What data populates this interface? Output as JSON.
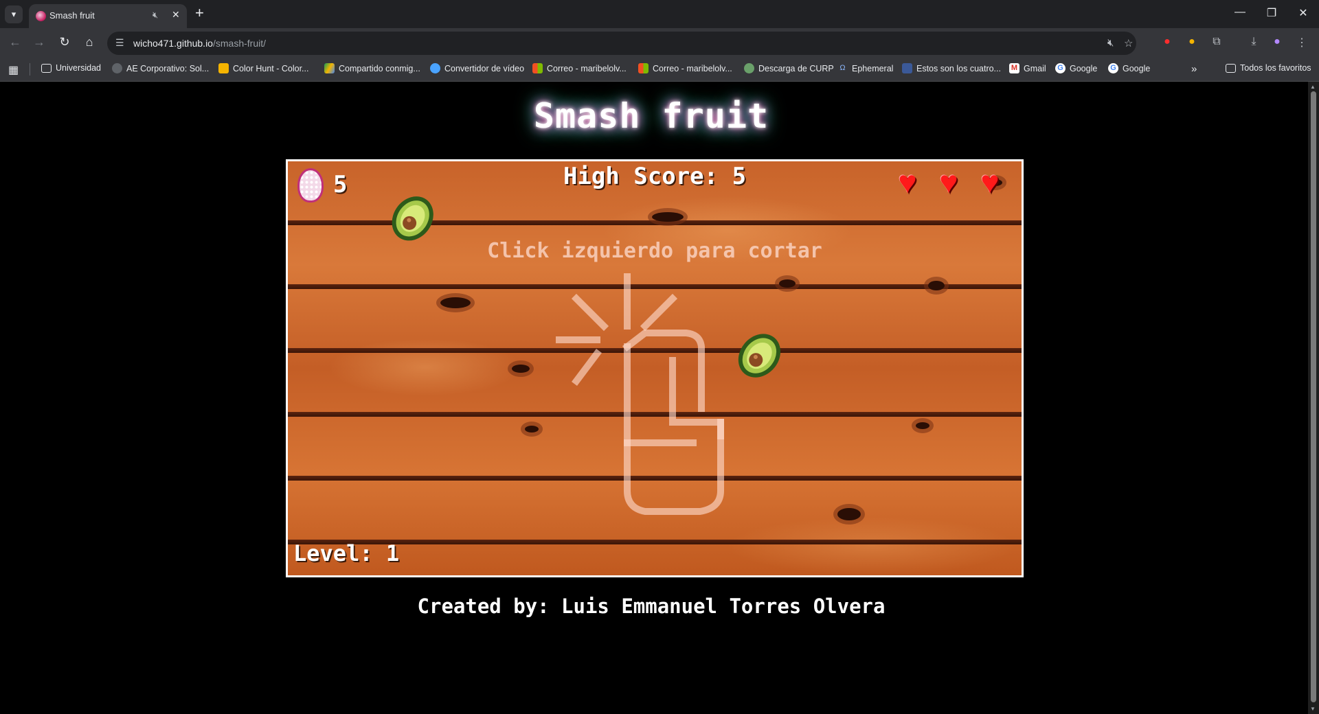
{
  "browser": {
    "tab_title": "Smash fruit",
    "url_host": "wicho471.github.io",
    "url_path": "/smash-fruit/",
    "bookmarks": [
      {
        "label": "Universidad",
        "icon": "folder-icon"
      },
      {
        "label": "AE Corporativo: Sol...",
        "icon": "globe-icon"
      },
      {
        "label": "Color Hunt - Color...",
        "icon": "colorhunt-icon"
      },
      {
        "label": "Compartido conmig...",
        "icon": "drive-icon"
      },
      {
        "label": "Convertidor de vídeo",
        "icon": "converter-icon"
      },
      {
        "label": "Correo - maribelolv...",
        "icon": "microsoft-icon"
      },
      {
        "label": "Correo - maribelolv...",
        "icon": "microsoft-icon"
      },
      {
        "label": "Descarga de CURP",
        "icon": "curp-icon"
      },
      {
        "label": "Ephemeral",
        "icon": "ephemeral-icon"
      },
      {
        "label": "Estos son los cuatro...",
        "icon": "news-icon"
      },
      {
        "label": "Gmail",
        "icon": "gmail-icon"
      },
      {
        "label": "Google",
        "icon": "google-icon"
      },
      {
        "label": "Google",
        "icon": "google-icon"
      }
    ],
    "all_bookmarks_label": "Todos los favoritos"
  },
  "game": {
    "title": "Smash fruit",
    "score": "5",
    "high_score_label": "High Score: 5",
    "lives": 3,
    "hint": "Click izquierdo para cortar",
    "level_label": "Level: 1",
    "fruits": [
      "avocado",
      "avocado"
    ]
  },
  "footer": {
    "credits": "Created by: Luis Emmanuel Torres Olvera"
  },
  "colors": {
    "background": "#000000",
    "canvas_border": "#ffffff",
    "heart": "#ff1a1a",
    "wood": "#c8632a"
  }
}
